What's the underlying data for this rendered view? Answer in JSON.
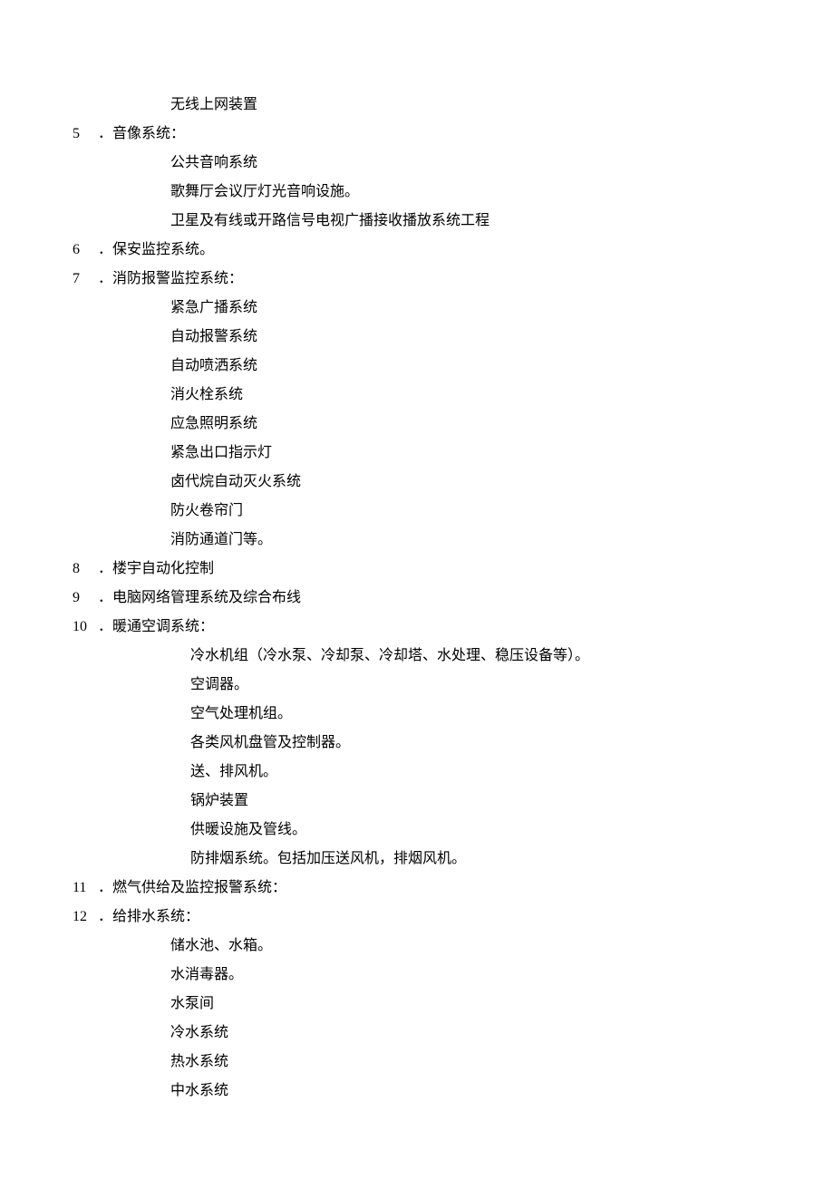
{
  "pre_items": [
    "无线上网装置"
  ],
  "sections": [
    {
      "number": "5",
      "title": "．音像系统：",
      "indent": "sub",
      "items": [
        "公共音响系统",
        "歌舞厅会议厅灯光音响设施。",
        "卫星及有线或开路信号电视广播接收播放系统工程"
      ]
    },
    {
      "number": "6",
      "title": "．保安监控系统。",
      "indent": "sub",
      "items": []
    },
    {
      "number": "7",
      "title": "．消防报警监控系统：",
      "indent": "sub",
      "items": [
        "紧急广播系统",
        "自动报警系统",
        "自动喷洒系统",
        "消火栓系统",
        "应急照明系统",
        "紧急出口指示灯",
        "卤代烷自动灭火系统",
        "防火卷帘门",
        "消防通道门等。"
      ]
    },
    {
      "number": "8",
      "title": "．楼宇自动化控制",
      "indent": "sub",
      "items": []
    },
    {
      "number": "9",
      "title": "．电脑网络管理系统及综合布线",
      "indent": "sub",
      "items": []
    },
    {
      "number": "10",
      "title": "．暖通空调系统：",
      "indent": "deep",
      "items": [
        "冷水机组（冷水泵、冷却泵、冷却塔、水处理、稳压设备等）。",
        "空调器。",
        "空气处理机组。",
        "各类风机盘管及控制器。",
        "送、排风机。",
        "锅炉装置",
        "供暖设施及管线。",
        "防排烟系统。包括加压送风机，排烟风机。"
      ]
    },
    {
      "number": "11",
      "title": "．燃气供给及监控报警系统：",
      "indent": "sub",
      "items": []
    },
    {
      "number": "12",
      "title": "．给排水系统：",
      "indent": "sub",
      "items": [
        "储水池、水箱。",
        "水消毒器。",
        "水泵间",
        "冷水系统",
        "热水系统",
        "中水系统"
      ]
    }
  ]
}
